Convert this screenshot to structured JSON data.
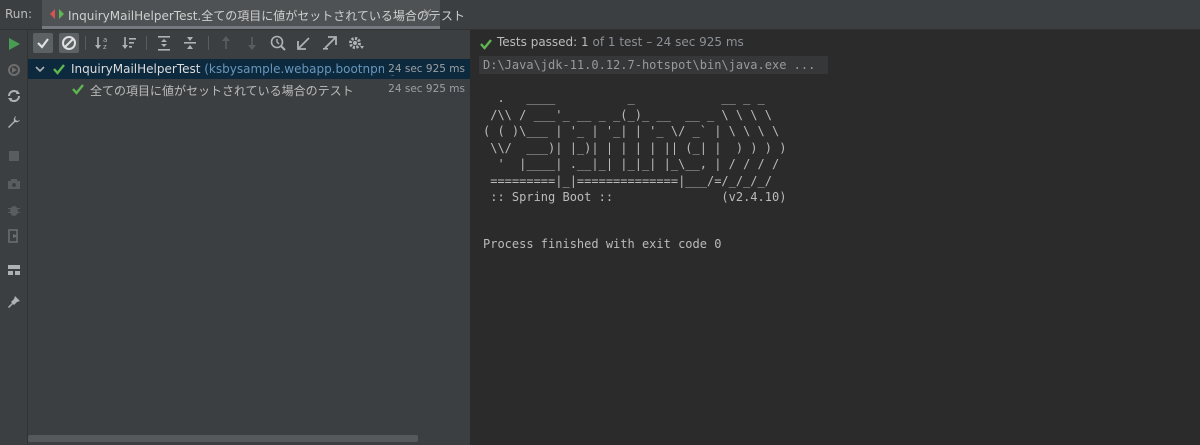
{
  "runbar": {
    "label": "Run:",
    "tab_title": "InquiryMailHelperTest.全ての項目に値がセットされている場合のテスト",
    "close_glyph": "×"
  },
  "left_strip": {
    "icons": [
      "run-icon",
      "rerun-failed-icon",
      "toggle-auto-test-icon",
      "settings-wrench-icon",
      "stop-icon",
      "screenshot-icon",
      "debug-icon",
      "exit-icon",
      "layout-icon",
      "pin-icon"
    ]
  },
  "toolbar": {
    "buttons": [
      "show-passed-icon",
      "show-ignored-icon",
      "sort-alphabetically-icon",
      "sort-by-duration-icon",
      "expand-all-icon",
      "collapse-all-icon",
      "previous-failed-icon",
      "next-failed-icon",
      "test-history-icon",
      "import-tests-icon",
      "export-results-icon",
      "settings-gear-icon"
    ]
  },
  "tree": {
    "rows": [
      {
        "name": "InquiryMailHelperTest",
        "package": " (ksbysample.webapp.bootnpmgeb.he",
        "time": "24 sec 925 ms",
        "selected": true
      },
      {
        "name": "全ての項目に値がセットされている場合のテスト",
        "package": "",
        "time": "24 sec 925 ms",
        "selected": false
      }
    ]
  },
  "console": {
    "status_label": "Tests passed:",
    "status_count": "1",
    "status_rest": "of 1 test – 24 sec 925 ms",
    "command_line": "D:\\Java\\jdk-11.0.12.7-hotspot\\bin\\java.exe ...",
    "banner": "  .   ____          _            __ _ _\n /\\\\ / ___'_ __ _ _(_)_ __  __ _ \\ \\ \\ \\\n( ( )\\___ | '_ | '_| | '_ \\/ _` | \\ \\ \\ \\\n \\\\/  ___)| |_)| | | | | || (_| |  ) ) ) )\n  '  |____| .__|_| |_|_| |_\\__, | / / / /\n =========|_|==============|___/=/_/_/_/\n :: Spring Boot ::               (v2.4.10)",
    "finished": "Process finished with exit code 0"
  },
  "colors": {
    "pass_green": "#5fb550",
    "selection": "#0d293e",
    "package_blue": "#6897bb"
  }
}
